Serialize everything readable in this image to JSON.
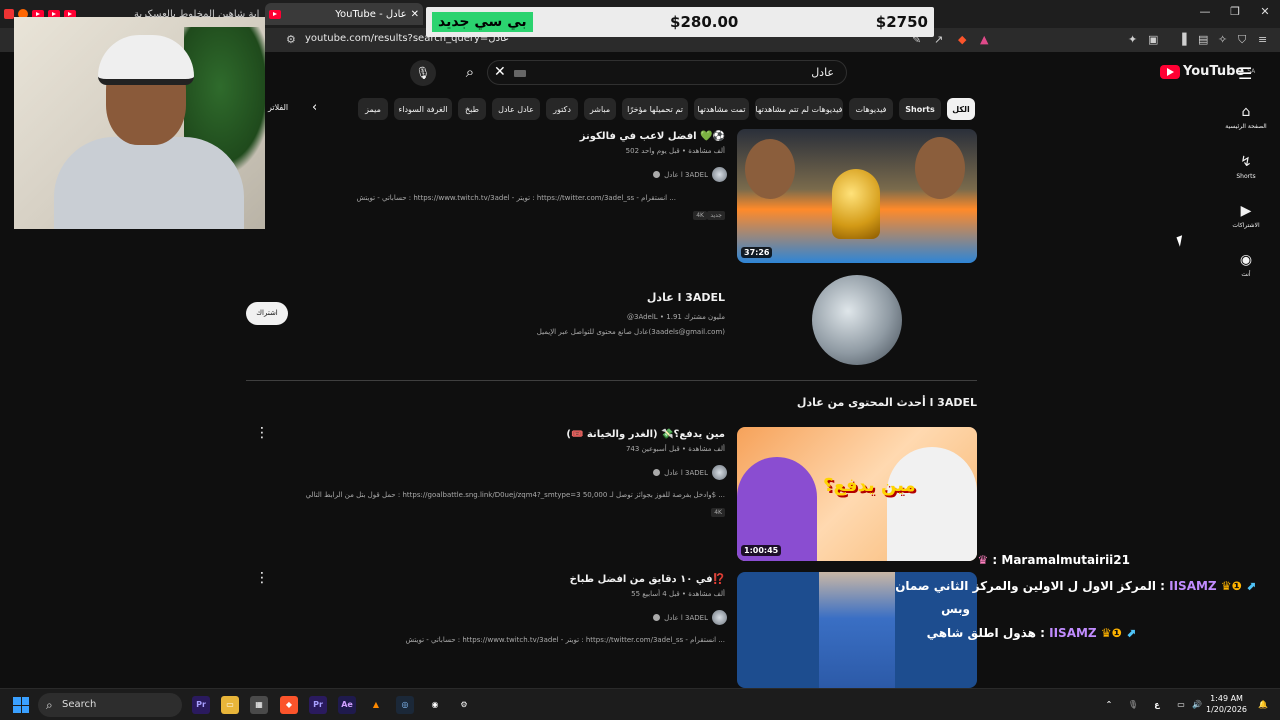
{
  "browser": {
    "tabs": [
      {
        "label": "بداية شاهين المخلوط بالعسكرية"
      },
      {
        "label": "YouTube - عادل"
      }
    ],
    "url": "youtube.com/results?search_query=عادل"
  },
  "overlay": {
    "price_tag": "بي سي جديد",
    "price_left": "$280.00",
    "price_right": "$2750"
  },
  "youtube": {
    "logo": "YouTube",
    "logo_region": "SA",
    "search_query": "عادل",
    "filters_label": "الفلاتر",
    "chips": [
      {
        "label": "الكل",
        "active": true
      },
      {
        "label": "Shorts"
      },
      {
        "label": "فيديوهات"
      },
      {
        "label": "فيديوهات لم تتم مشاهدتها"
      },
      {
        "label": "تمت مشاهدتها"
      },
      {
        "label": "تم تحميلها مؤخرًا"
      },
      {
        "label": "مباشر"
      },
      {
        "label": "دكتور"
      },
      {
        "label": "عادل عادل"
      },
      {
        "label": "طبخ"
      },
      {
        "label": "الغرفة السوداء"
      },
      {
        "label": "ميمز"
      }
    ],
    "sidebar": [
      {
        "label": "الصفحة الرئيسية",
        "icon": "home-icon"
      },
      {
        "label": "Shorts",
        "icon": "shorts-icon"
      },
      {
        "label": "الاشتراكات",
        "icon": "subscriptions-icon"
      },
      {
        "label": "أنت",
        "icon": "you-icon"
      }
    ],
    "results": [
      {
        "title": "افضل لاعب في فالكونز 💚⚽",
        "meta": "502 ألف مشاهدة • قبل يوم واحد",
        "channel": "عادل l 3ADEL",
        "desc": "حساباتي - تويتش : https://www.twitch.tv/3adel - تويتر : https://twitter.com/3adel_ss - انستقرام ...",
        "badges": [
          "جديد",
          "4K"
        ],
        "duration": "37:26"
      }
    ],
    "channel": {
      "name": "عادل l 3ADEL",
      "handle_subs": "@3AdelL • 1.91 مليون مشترك",
      "desc": "عادل صانع محتوى للتواصل عبر الإيميل(3aadels@gmail.com)",
      "subscribe_label": "اشتراك"
    },
    "section_title": "أحدث المحتوى من عادل l 3ADEL",
    "latest": [
      {
        "title": "مين يدفع؟💸 (الغدر والخيانة 🎟️)",
        "meta": "743 ألف مشاهدة • قبل أسبوعين",
        "channel": "عادل l 3ADEL",
        "desc": "حمل قول بتل من الرابط التالي : https://goalbattle.sng.link/D0uej/zqm4?_smtype=3 وادخل بفرصة للفوز بجوائز توصل لـ 50,000$ ...",
        "badges": [
          "4K"
        ],
        "duration": "1:00:45",
        "thumb_text": "مين يدفع؟"
      },
      {
        "title": "في ١٠ دقايق من افضل طباخ⁉️",
        "meta": "55 ألف مشاهدة • قبل 4 أسابيع",
        "channel": "عادل l 3ADEL",
        "desc": "حساباتي - تويتش : https://www.twitch.tv/3adel - تويتر : https://twitter.com/3adel_ss - انستقرام ..."
      }
    ]
  },
  "chat": [
    {
      "name": "Maramalmutairii21",
      "text": "",
      "color": "#ffffff"
    },
    {
      "name": "IISAMZ",
      "text": "المركز الاول ل الاولين والمركز الثاني صمان : ",
      "color": "#c18cff"
    },
    {
      "name": "",
      "text": "وبس",
      "color": "#ffffff"
    },
    {
      "name": "IISAMZ",
      "text": "هذول اطلق شاهي : ",
      "color": "#c18cff"
    }
  ],
  "taskbar": {
    "search_label": "Search",
    "time": "1:49 AM",
    "date": "1/20/2026",
    "lang": "ع"
  },
  "colors": {
    "background": "#0f0f0f",
    "accent_red": "#ff0033",
    "price_green": "#2bd36f",
    "chat_name": "#c18cff"
  }
}
